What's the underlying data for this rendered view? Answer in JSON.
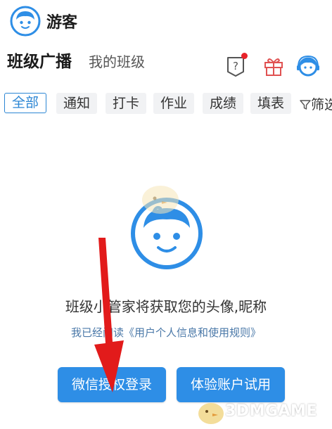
{
  "header": {
    "user_name": "游客",
    "tabs": [
      {
        "label": "班级广播",
        "active": true
      },
      {
        "label": "我的班级",
        "active": false
      }
    ],
    "icons": [
      "help-icon",
      "gift-icon",
      "support-icon"
    ],
    "notification_dot_color": "#e8232a"
  },
  "filters": {
    "chips": [
      {
        "label": "全部",
        "active": true
      },
      {
        "label": "通知",
        "active": false
      },
      {
        "label": "打卡",
        "active": false
      },
      {
        "label": "作业",
        "active": false
      },
      {
        "label": "成绩",
        "active": false
      },
      {
        "label": "填表",
        "active": false
      }
    ],
    "filter_label": "筛选"
  },
  "empty_state": {
    "message": "班级小管家将获取您的头像,昵称",
    "rules_text": "我已经阅读《用户个人信息和使用规则》"
  },
  "buttons": {
    "wechat_login": "微信授权登录",
    "trial": "体验账户试用"
  },
  "colors": {
    "accent": "#2e8ee6",
    "arrow": "#e21b1b"
  },
  "watermark": "3DMGAME"
}
